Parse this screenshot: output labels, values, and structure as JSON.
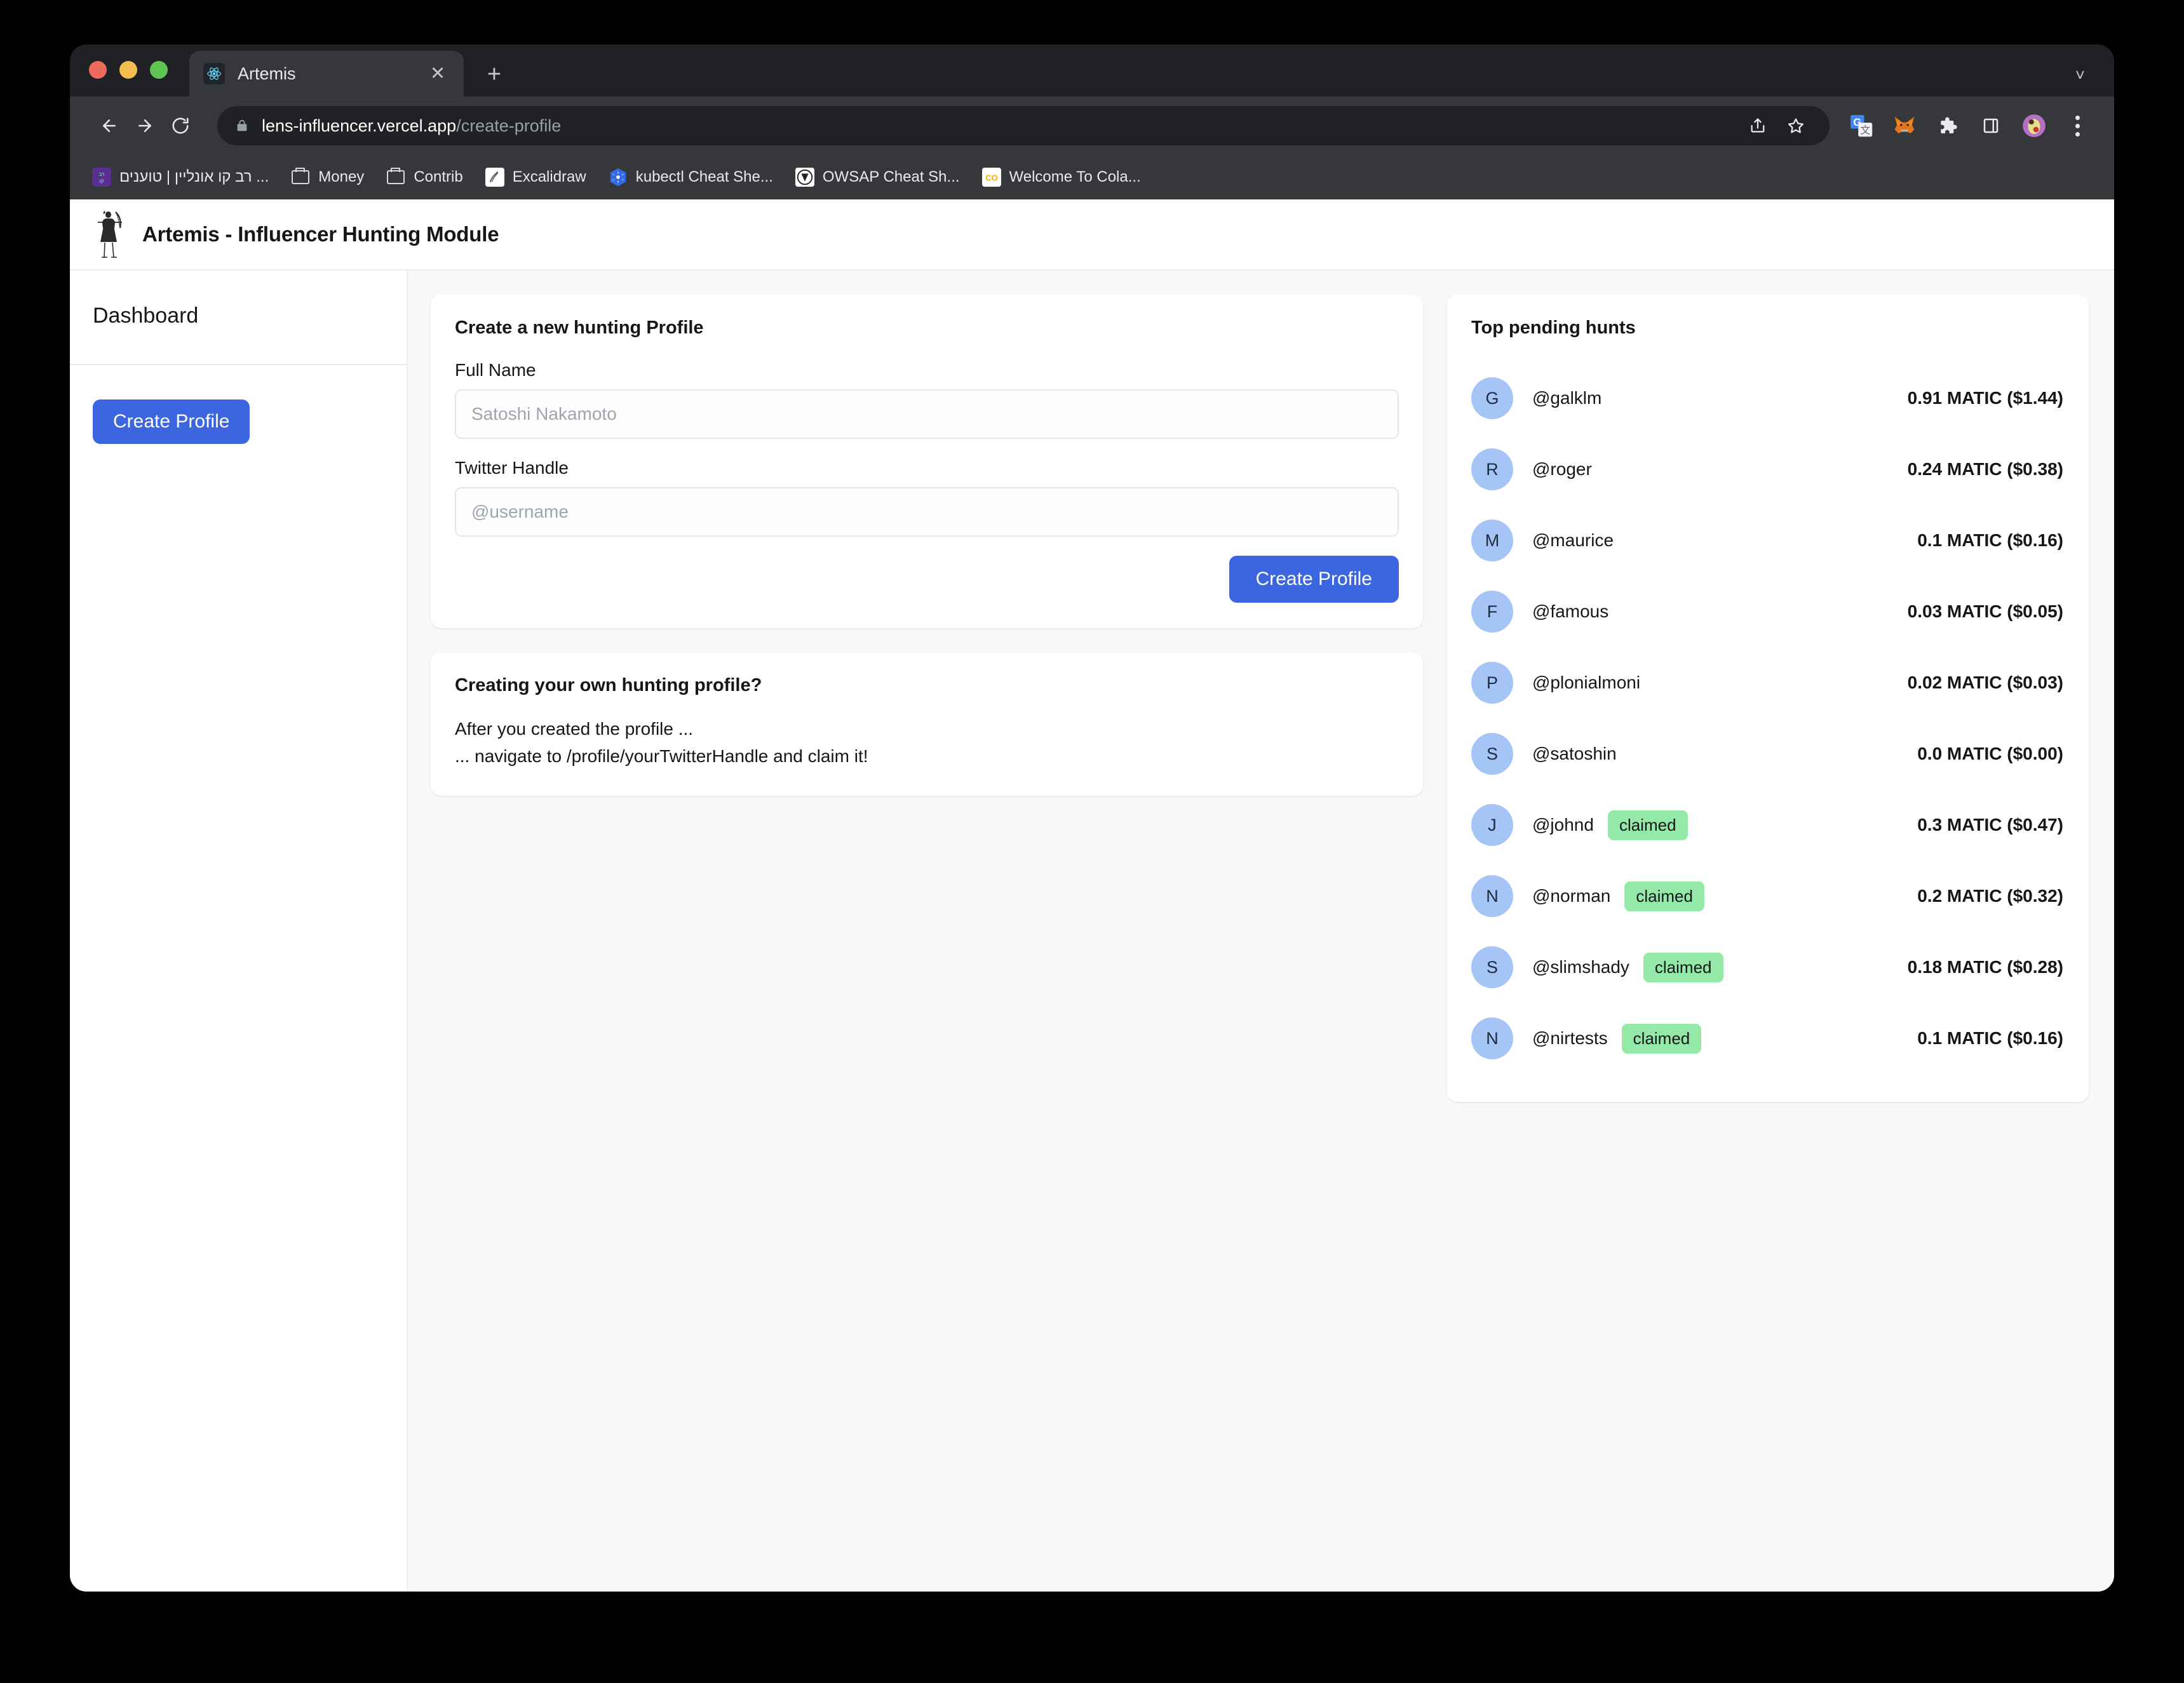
{
  "browser": {
    "tab": {
      "title": "Artemis",
      "favicon_icon": "react-logo-icon",
      "close_icon": "close-icon"
    },
    "new_tab_label": "+",
    "tabstrip_chevron_icon": "chevron-down-icon",
    "nav": {
      "back_icon": "back-arrow-icon",
      "forward_icon": "forward-arrow-icon",
      "reload_icon": "reload-icon"
    },
    "omnibox": {
      "lock_icon": "lock-icon",
      "url_domain": "lens-influencer.vercel.app",
      "url_path": "/create-profile",
      "share_icon": "share-icon",
      "bookmark_icon": "star-icon"
    },
    "extensions": [
      {
        "name": "google-translate-icon"
      },
      {
        "name": "metamask-fox-icon"
      },
      {
        "name": "extensions-puzzle-icon"
      },
      {
        "name": "side-panel-icon"
      },
      {
        "name": "profile-avatar-icon"
      }
    ],
    "menu_icon": "three-dots-menu-icon",
    "bookmarks": [
      {
        "label": "רב קו אונליין | טוענים ...",
        "icon": "ravkav-icon"
      },
      {
        "label": "Money",
        "icon": "folder-icon"
      },
      {
        "label": "Contrib",
        "icon": "folder-icon"
      },
      {
        "label": "Excalidraw",
        "icon": "excalidraw-icon"
      },
      {
        "label": "kubectl Cheat She...",
        "icon": "kubernetes-icon"
      },
      {
        "label": "OWSAP Cheat Sh...",
        "icon": "owasp-icon"
      },
      {
        "label": "Welcome To Cola...",
        "icon": "colab-icon"
      }
    ]
  },
  "app": {
    "title": "Artemis - Influencer Hunting Module",
    "logo_icon": "archer-logo-icon"
  },
  "sidebar": {
    "title": "Dashboard",
    "create_profile_label": "Create Profile"
  },
  "form_card": {
    "title": "Create a new hunting Profile",
    "full_name_label": "Full Name",
    "full_name_placeholder": "Satoshi Nakamoto",
    "full_name_value": "",
    "twitter_handle_label": "Twitter Handle",
    "twitter_handle_placeholder": "@username",
    "twitter_handle_value": "",
    "submit_label": "Create Profile"
  },
  "info_card": {
    "title": "Creating your own hunting profile?",
    "line1": "After you created the profile ...",
    "line2": "... navigate to /profile/yourTwitterHandle and claim it!"
  },
  "hunts_panel": {
    "title": "Top pending hunts",
    "badge_label": "claimed",
    "avatar_color": "#a6c5f7",
    "badge_color": "#94e8a8",
    "accent_color": "#3b66e0",
    "rows": [
      {
        "initial": "G",
        "handle": "@galklm",
        "claimed": false,
        "amount": "0.91 MATIC ($1.44)"
      },
      {
        "initial": "R",
        "handle": "@roger",
        "claimed": false,
        "amount": "0.24 MATIC ($0.38)"
      },
      {
        "initial": "M",
        "handle": "@maurice",
        "claimed": false,
        "amount": "0.1 MATIC ($0.16)"
      },
      {
        "initial": "F",
        "handle": "@famous",
        "claimed": false,
        "amount": "0.03 MATIC ($0.05)"
      },
      {
        "initial": "P",
        "handle": "@plonialmoni",
        "claimed": false,
        "amount": "0.02 MATIC ($0.03)"
      },
      {
        "initial": "S",
        "handle": "@satoshin",
        "claimed": false,
        "amount": "0.0 MATIC ($0.00)"
      },
      {
        "initial": "J",
        "handle": "@johnd",
        "claimed": true,
        "amount": "0.3 MATIC ($0.47)"
      },
      {
        "initial": "N",
        "handle": "@norman",
        "claimed": true,
        "amount": "0.2 MATIC ($0.32)"
      },
      {
        "initial": "S",
        "handle": "@slimshady",
        "claimed": true,
        "amount": "0.18 MATIC ($0.28)"
      },
      {
        "initial": "N",
        "handle": "@nirtests",
        "claimed": true,
        "amount": "0.1 MATIC ($0.16)"
      }
    ]
  }
}
